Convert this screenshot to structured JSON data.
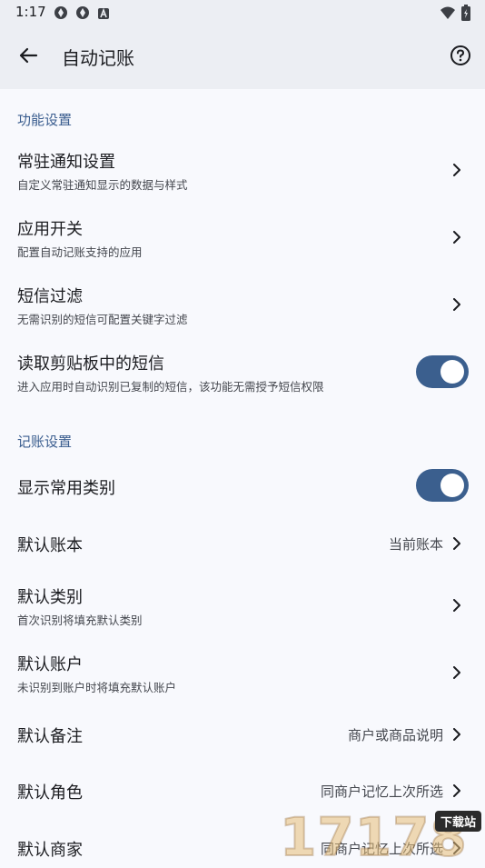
{
  "status_bar": {
    "time": "1:17",
    "left_icons": [
      "app-icon",
      "app-icon",
      "notification-a-icon"
    ],
    "right_icons": [
      "wifi-icon",
      "battery-charging-icon"
    ]
  },
  "app_bar": {
    "title": "自动记账",
    "back_icon": "arrow-left-icon",
    "help_icon": "help-circle-icon"
  },
  "sections": [
    {
      "header": "功能设置",
      "items": [
        {
          "title": "常驻通知设置",
          "subtitle": "自定义常驻通知显示的数据与样式",
          "control": "chevron"
        },
        {
          "title": "应用开关",
          "subtitle": "配置自动记账支持的应用",
          "control": "chevron"
        },
        {
          "title": "短信过滤",
          "subtitle": "无需识别的短信可配置关键字过滤",
          "control": "chevron"
        },
        {
          "title": "读取剪贴板中的短信",
          "subtitle": "进入应用时自动识别已复制的短信，该功能无需授予短信权限",
          "control": "toggle",
          "checked": true
        }
      ]
    },
    {
      "header": "记账设置",
      "items": [
        {
          "title": "显示常用类别",
          "control": "toggle",
          "checked": true
        },
        {
          "title": "默认账本",
          "value": "当前账本",
          "control": "chevron"
        },
        {
          "title": "默认类别",
          "subtitle": "首次识别将填充默认类别",
          "control": "chevron"
        },
        {
          "title": "默认账户",
          "subtitle": "未识别到账户时将填充默认账户",
          "control": "chevron"
        },
        {
          "title": "默认备注",
          "value": "商户或商品说明",
          "control": "chevron"
        },
        {
          "title": "默认角色",
          "value": "同商户记忆上次所选",
          "control": "chevron"
        },
        {
          "title": "默认商家",
          "value": "同商户记忆上次所选",
          "control": "chevron"
        }
      ]
    }
  ],
  "watermark": {
    "text": "17178",
    "badge": "下载站"
  },
  "colors": {
    "background": "#f8f9fd",
    "app_bar": "#eceef3",
    "accent": "#3b5f8e",
    "section_header": "#3a5d8f",
    "primary_text": "#1b1c20",
    "secondary_text": "#44474e"
  }
}
